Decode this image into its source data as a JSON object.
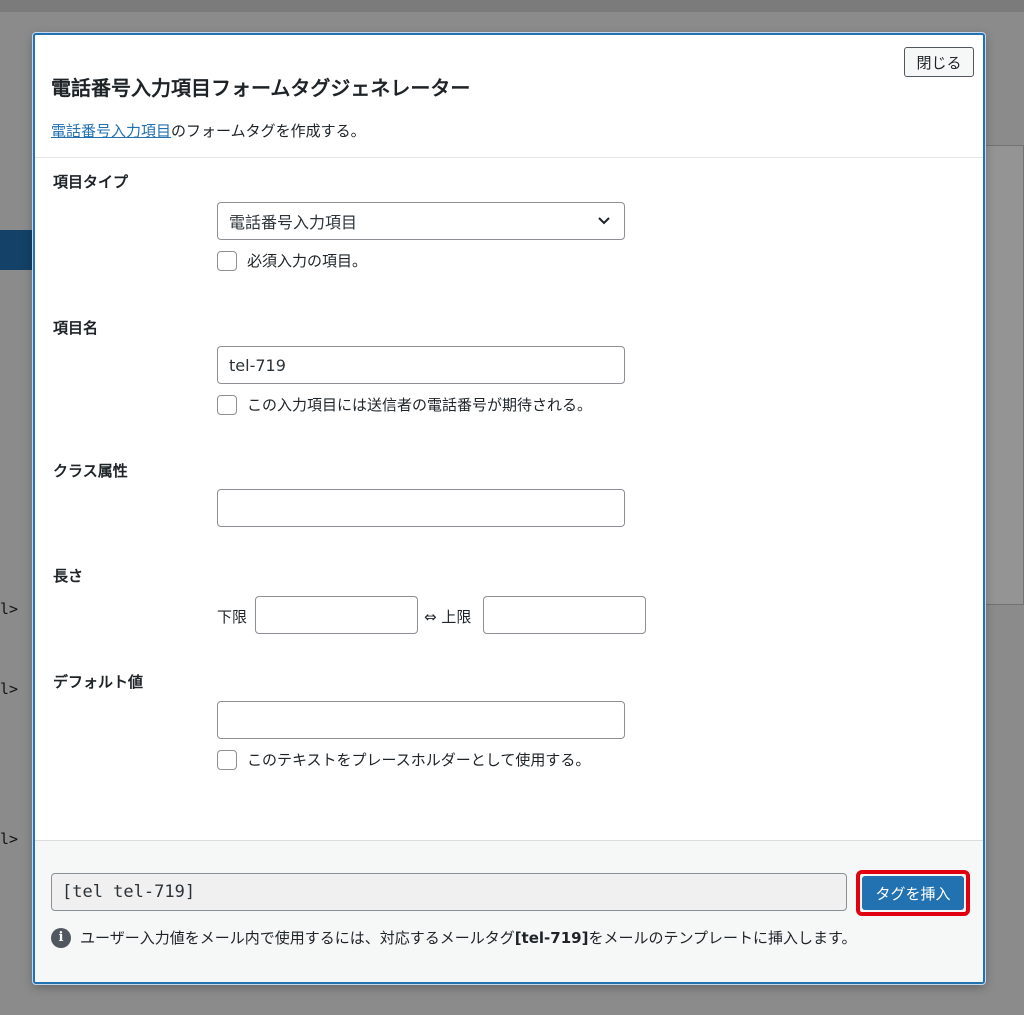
{
  "modal": {
    "close_label": "閉じる",
    "title": "電話番号入力項目フォームタグジェネレーター",
    "desc_link": "電話番号入力項目",
    "desc_rest": "のフォームタグを作成する。",
    "field_type": {
      "label": "項目タイプ",
      "select_value": "電話番号入力項目",
      "required_label": "必須入力の項目。"
    },
    "field_name": {
      "label": "項目名",
      "value": "tel-719",
      "expect_label": "この入力項目には送信者の電話番号が期待される。"
    },
    "class_attr": {
      "label": "クラス属性",
      "value": ""
    },
    "length": {
      "label": "長さ",
      "min_label": "下限",
      "sep_label": "⇔ 上限",
      "min_value": "",
      "max_value": ""
    },
    "default_value": {
      "label": "デフォルト値",
      "value": "",
      "placeholder_label": "このテキストをプレースホルダーとして使用する。"
    },
    "footer": {
      "tag_output": "[tel tel-719]",
      "insert_label": "タグを挿入",
      "info_prefix": "ユーザー入力値をメール内で使用するには、対応するメールタグ ",
      "info_tag": "[tel-719]",
      "info_suffix": " をメールのテンプレートに挿入します。"
    }
  },
  "colors": {
    "accent": "#2271b1",
    "highlight_border": "#e0000f"
  }
}
